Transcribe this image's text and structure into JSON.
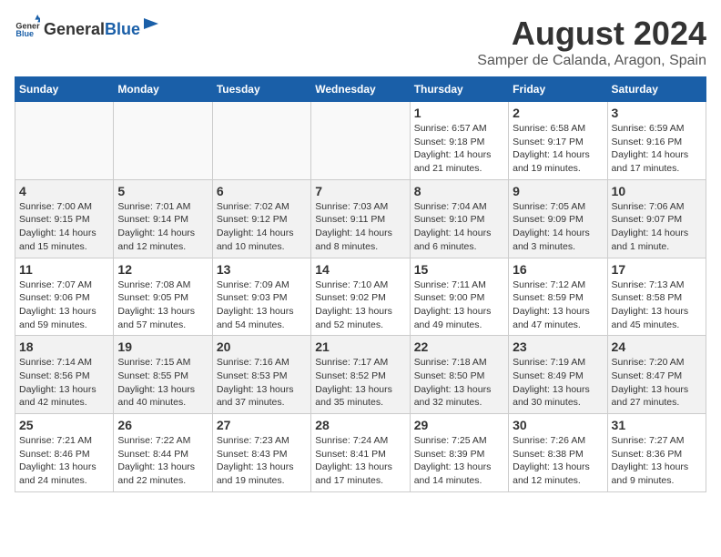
{
  "logo": {
    "general": "General",
    "blue": "Blue"
  },
  "title": "August 2024",
  "subtitle": "Samper de Calanda, Aragon, Spain",
  "weekdays": [
    "Sunday",
    "Monday",
    "Tuesday",
    "Wednesday",
    "Thursday",
    "Friday",
    "Saturday"
  ],
  "weeks": [
    [
      {
        "day": "",
        "empty": true
      },
      {
        "day": "",
        "empty": true
      },
      {
        "day": "",
        "empty": true
      },
      {
        "day": "",
        "empty": true
      },
      {
        "day": "1",
        "sunrise": "6:57 AM",
        "sunset": "9:18 PM",
        "daylight": "14 hours and 21 minutes."
      },
      {
        "day": "2",
        "sunrise": "6:58 AM",
        "sunset": "9:17 PM",
        "daylight": "14 hours and 19 minutes."
      },
      {
        "day": "3",
        "sunrise": "6:59 AM",
        "sunset": "9:16 PM",
        "daylight": "14 hours and 17 minutes."
      }
    ],
    [
      {
        "day": "4",
        "sunrise": "7:00 AM",
        "sunset": "9:15 PM",
        "daylight": "14 hours and 15 minutes."
      },
      {
        "day": "5",
        "sunrise": "7:01 AM",
        "sunset": "9:14 PM",
        "daylight": "14 hours and 12 minutes."
      },
      {
        "day": "6",
        "sunrise": "7:02 AM",
        "sunset": "9:12 PM",
        "daylight": "14 hours and 10 minutes."
      },
      {
        "day": "7",
        "sunrise": "7:03 AM",
        "sunset": "9:11 PM",
        "daylight": "14 hours and 8 minutes."
      },
      {
        "day": "8",
        "sunrise": "7:04 AM",
        "sunset": "9:10 PM",
        "daylight": "14 hours and 6 minutes."
      },
      {
        "day": "9",
        "sunrise": "7:05 AM",
        "sunset": "9:09 PM",
        "daylight": "14 hours and 3 minutes."
      },
      {
        "day": "10",
        "sunrise": "7:06 AM",
        "sunset": "9:07 PM",
        "daylight": "14 hours and 1 minute."
      }
    ],
    [
      {
        "day": "11",
        "sunrise": "7:07 AM",
        "sunset": "9:06 PM",
        "daylight": "13 hours and 59 minutes."
      },
      {
        "day": "12",
        "sunrise": "7:08 AM",
        "sunset": "9:05 PM",
        "daylight": "13 hours and 57 minutes."
      },
      {
        "day": "13",
        "sunrise": "7:09 AM",
        "sunset": "9:03 PM",
        "daylight": "13 hours and 54 minutes."
      },
      {
        "day": "14",
        "sunrise": "7:10 AM",
        "sunset": "9:02 PM",
        "daylight": "13 hours and 52 minutes."
      },
      {
        "day": "15",
        "sunrise": "7:11 AM",
        "sunset": "9:00 PM",
        "daylight": "13 hours and 49 minutes."
      },
      {
        "day": "16",
        "sunrise": "7:12 AM",
        "sunset": "8:59 PM",
        "daylight": "13 hours and 47 minutes."
      },
      {
        "day": "17",
        "sunrise": "7:13 AM",
        "sunset": "8:58 PM",
        "daylight": "13 hours and 45 minutes."
      }
    ],
    [
      {
        "day": "18",
        "sunrise": "7:14 AM",
        "sunset": "8:56 PM",
        "daylight": "13 hours and 42 minutes."
      },
      {
        "day": "19",
        "sunrise": "7:15 AM",
        "sunset": "8:55 PM",
        "daylight": "13 hours and 40 minutes."
      },
      {
        "day": "20",
        "sunrise": "7:16 AM",
        "sunset": "8:53 PM",
        "daylight": "13 hours and 37 minutes."
      },
      {
        "day": "21",
        "sunrise": "7:17 AM",
        "sunset": "8:52 PM",
        "daylight": "13 hours and 35 minutes."
      },
      {
        "day": "22",
        "sunrise": "7:18 AM",
        "sunset": "8:50 PM",
        "daylight": "13 hours and 32 minutes."
      },
      {
        "day": "23",
        "sunrise": "7:19 AM",
        "sunset": "8:49 PM",
        "daylight": "13 hours and 30 minutes."
      },
      {
        "day": "24",
        "sunrise": "7:20 AM",
        "sunset": "8:47 PM",
        "daylight": "13 hours and 27 minutes."
      }
    ],
    [
      {
        "day": "25",
        "sunrise": "7:21 AM",
        "sunset": "8:46 PM",
        "daylight": "13 hours and 24 minutes."
      },
      {
        "day": "26",
        "sunrise": "7:22 AM",
        "sunset": "8:44 PM",
        "daylight": "13 hours and 22 minutes."
      },
      {
        "day": "27",
        "sunrise": "7:23 AM",
        "sunset": "8:43 PM",
        "daylight": "13 hours and 19 minutes."
      },
      {
        "day": "28",
        "sunrise": "7:24 AM",
        "sunset": "8:41 PM",
        "daylight": "13 hours and 17 minutes."
      },
      {
        "day": "29",
        "sunrise": "7:25 AM",
        "sunset": "8:39 PM",
        "daylight": "13 hours and 14 minutes."
      },
      {
        "day": "30",
        "sunrise": "7:26 AM",
        "sunset": "8:38 PM",
        "daylight": "13 hours and 12 minutes."
      },
      {
        "day": "31",
        "sunrise": "7:27 AM",
        "sunset": "8:36 PM",
        "daylight": "13 hours and 9 minutes."
      }
    ]
  ],
  "labels": {
    "sunrise": "Sunrise: ",
    "sunset": "Sunset: ",
    "daylight": "Daylight: "
  }
}
